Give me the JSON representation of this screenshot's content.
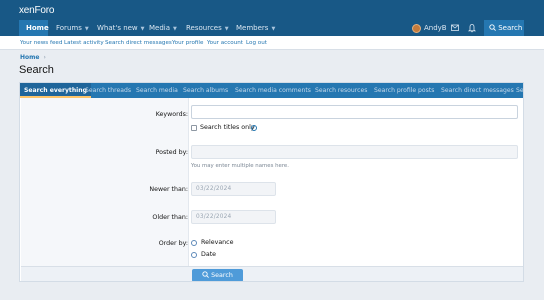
{
  "header": {
    "logo_text": "xenForo"
  },
  "nav": {
    "items": [
      {
        "label": "Home"
      },
      {
        "label": "Forums"
      },
      {
        "label": "What's new"
      },
      {
        "label": "Media"
      },
      {
        "label": "Resources"
      },
      {
        "label": "Members"
      }
    ],
    "user": "AndyB",
    "search_label": "Search"
  },
  "subnav": {
    "items": [
      "Your news feed",
      "Latest activity",
      "Search direct messages",
      "Your profile",
      "Your account",
      "Log out"
    ]
  },
  "breadcrumb": {
    "home": "Home",
    "separator": "›"
  },
  "page": {
    "title": "Search"
  },
  "tabs": [
    "Search everything",
    "Search threads",
    "Search media",
    "Search albums",
    "Search media comments",
    "Search resources",
    "Search profile posts",
    "Search direct messages",
    "Se"
  ],
  "form": {
    "keywords_label": "Keywords:",
    "keywords_value": "",
    "titles_only_label": "Search titles only",
    "help_glyph": "?",
    "posted_by_label": "Posted by:",
    "posted_by_value": "",
    "posted_by_hint": "You may enter multiple names here.",
    "newer_than_label": "Newer than:",
    "newer_than_value": "03/22/2024",
    "older_than_label": "Older than:",
    "older_than_value": "03/22/2024",
    "order_by_label": "Order by:",
    "order_options": [
      "Relevance",
      "Date"
    ],
    "submit_label": "Search"
  },
  "colors": {
    "header_bg": "#185886",
    "tab_bar_bg": "#2577b1",
    "link": "#2577b1",
    "submit_bg": "#4f9bd9"
  }
}
